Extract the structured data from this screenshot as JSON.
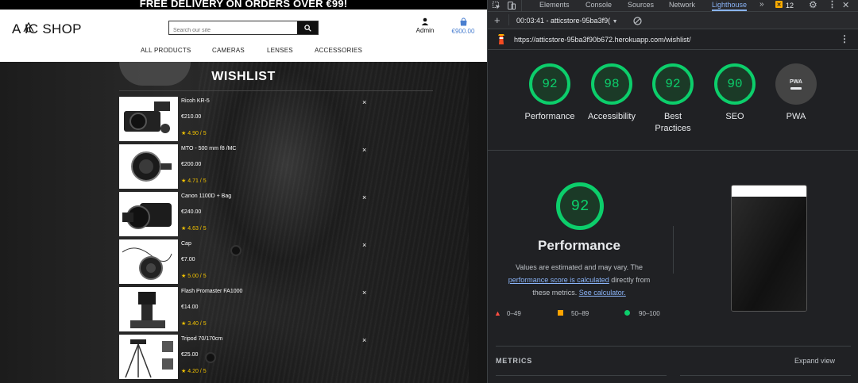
{
  "shop": {
    "promo": "FREE DELIVERY ON ORDERS OVER €99!",
    "logo": "A IC SHOP",
    "search_placeholder": "Search our site",
    "account_label": "Admin",
    "bag_total": "€900.00",
    "nav": [
      "ALL PRODUCTS",
      "CAMERAS",
      "LENSES",
      "ACCESSORIES"
    ],
    "page_title": "WISHLIST",
    "items": [
      {
        "name": "Ricoh KR-5",
        "price": "€210.00",
        "rating": "4.90 / 5",
        "remove": "×"
      },
      {
        "name": "MTO - 500 mm f8 /MC",
        "price": "€200.00",
        "rating": "4.71 / 5",
        "remove": "×"
      },
      {
        "name": "Canon 1100D + Bag",
        "price": "€240.00",
        "rating": "4.63 / 5",
        "remove": "×"
      },
      {
        "name": "Cap",
        "price": "€7.00",
        "rating": "5.00 / 5",
        "remove": "×"
      },
      {
        "name": "Flash Promaster FA1000",
        "price": "€14.00",
        "rating": "3.40 / 5",
        "remove": "×"
      },
      {
        "name": "Tripod 70/170cm",
        "price": "€25.00",
        "rating": "4.20 / 5",
        "remove": "×"
      }
    ]
  },
  "devtools": {
    "tabs": [
      "Elements",
      "Console",
      "Sources",
      "Network",
      "Lighthouse"
    ],
    "active_tab": "Lighthouse",
    "more_tabs": "»",
    "warnings_count": "12",
    "report_label": "00:03:41 - atticstore-95ba3f9(",
    "url": "https://atticstore-95ba3f90b672.herokuapp.com/wishlist/",
    "scores": [
      {
        "label": "Performance",
        "value": "92"
      },
      {
        "label": "Accessibility",
        "value": "98"
      },
      {
        "label": "Best Practices",
        "value": "92"
      },
      {
        "label": "SEO",
        "value": "90"
      }
    ],
    "pwa_label": "PWA",
    "pwa_badge": "PWA",
    "main_score": "92",
    "main_title": "Performance",
    "desc_1": "Values are estimated and may vary. The",
    "desc_link_1": "performance score is calculated",
    "desc_2": "directly from",
    "desc_3": "these metrics.",
    "desc_link_2": "See calculator.",
    "legend": [
      {
        "range": "0–49",
        "color": "#ff4e42"
      },
      {
        "range": "50–89",
        "color": "#ffa400"
      },
      {
        "range": "90–100",
        "color": "#0cce6b"
      }
    ],
    "metrics_label": "METRICS",
    "expand_label": "Expand view"
  }
}
